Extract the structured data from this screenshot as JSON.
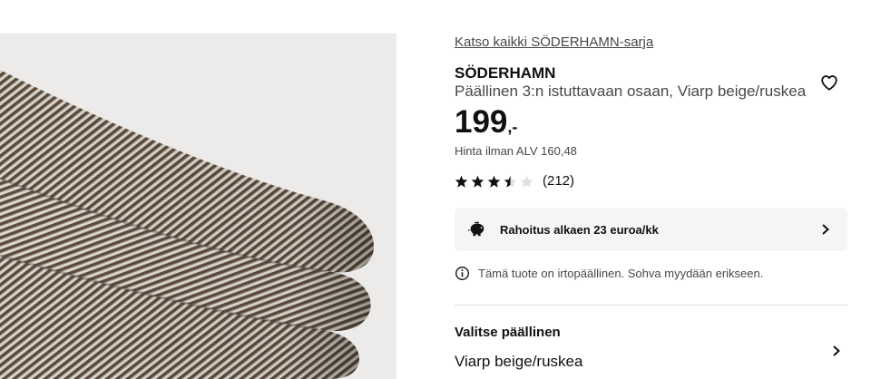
{
  "product": {
    "series_link": "Katso kaikki SÖDERHAMN-sarja",
    "name": "SÖDERHAMN",
    "description": "Päällinen 3:n istuttavaan osaan, Viarp beige/ruskea",
    "price_integer": "199",
    "price_suffix": ",-",
    "price_excl_vat": "Hinta ilman ALV 160,48",
    "rating_value": 3.5,
    "rating_max": 5,
    "rating_count": "(212)",
    "image_icon": "fabric-texture-image"
  },
  "wishlist": {
    "icon": "heart-icon"
  },
  "finance": {
    "label": "Rahoitus alkaen 23 euroa/kk",
    "icon": "piggy-bank-icon"
  },
  "notice": {
    "text": "Tämä tuote on irtopäällinen. Sohva myydään erikseen.",
    "icon": "info-icon"
  },
  "cover_select": {
    "title": "Valitse päällinen",
    "value": "Viarp beige/ruskea",
    "icon": "chevron-right-icon"
  },
  "colors": {
    "text_primary": "#111111",
    "text_secondary": "#484848",
    "panel_bg": "#f5f5f5",
    "divider": "#dfdfdf"
  }
}
